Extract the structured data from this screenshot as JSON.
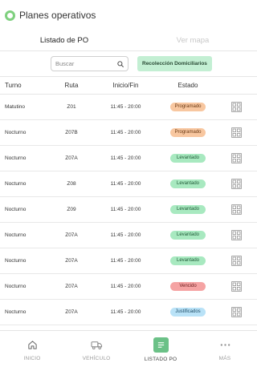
{
  "app": {
    "title": "Planes operativos"
  },
  "tabs": [
    {
      "label": "Listado de PO",
      "active": true
    },
    {
      "label": "Ver mapa",
      "active": false
    }
  ],
  "filters": {
    "search_placeholder": "Buscar",
    "search_value": "",
    "chip_label": "Recolección Domiciliarios"
  },
  "table": {
    "headers": {
      "turno": "Turno",
      "ruta": "Ruta",
      "hora": "Inicio/Fin",
      "estado": "Estado"
    },
    "rows": [
      {
        "turno": "Matutino",
        "ruta": "Z01",
        "hora": "11:45 - 20:00",
        "estado": "Programado"
      },
      {
        "turno": "Nocturno",
        "ruta": "Z07B",
        "hora": "11:45 - 20:00",
        "estado": "Programado"
      },
      {
        "turno": "Nocturno",
        "ruta": "Z07A",
        "hora": "11:45 - 20:00",
        "estado": "Levantado"
      },
      {
        "turno": "Nocturno",
        "ruta": "Z08",
        "hora": "11:45 - 20:00",
        "estado": "Levantado"
      },
      {
        "turno": "Nocturno",
        "ruta": "Z09",
        "hora": "11:45 - 20:00",
        "estado": "Levantado"
      },
      {
        "turno": "Nocturno",
        "ruta": "Z07A",
        "hora": "11:45 - 20:00",
        "estado": "Levantado"
      },
      {
        "turno": "Nocturno",
        "ruta": "Z07A",
        "hora": "11:45 - 20:00",
        "estado": "Levantado"
      },
      {
        "turno": "Nocturno",
        "ruta": "Z07A",
        "hora": "11:45 - 20:00",
        "estado": "Vencido"
      },
      {
        "turno": "Nocturno",
        "ruta": "Z07A",
        "hora": "11:45 - 20:00",
        "estado": "Justificados"
      }
    ]
  },
  "status_colors": {
    "Programado": {
      "bg": "#f8c7a0",
      "fg": "#6b3a14"
    },
    "Levantado": {
      "bg": "#a8e9c0",
      "fg": "#1f5a36"
    },
    "Vencido": {
      "bg": "#f5a3a3",
      "fg": "#6b1e1e"
    },
    "Justificados": {
      "bg": "#b9e2f7",
      "fg": "#1e4c66"
    }
  },
  "nav": {
    "items": [
      {
        "label": "INICIO",
        "icon": "home-icon",
        "active": false
      },
      {
        "label": "VEHÍCULO",
        "icon": "truck-icon",
        "active": false
      },
      {
        "label": "LISTADO PO",
        "icon": "list-icon",
        "active": true
      },
      {
        "label": "MÁS",
        "icon": "more-icon",
        "active": false
      }
    ]
  },
  "colors": {
    "accent": "#6bc187",
    "logo": "#7ed07e"
  }
}
